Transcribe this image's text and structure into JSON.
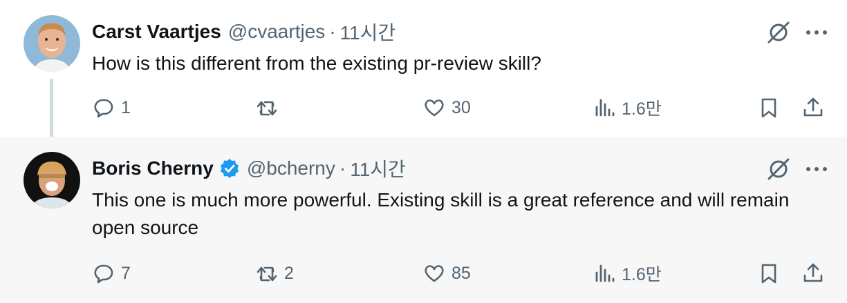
{
  "tweets": [
    {
      "author_name": "Carst Vaartjes",
      "handle": "@cvaartjes",
      "separator": "·",
      "time": "11시간",
      "text": "How is this different from the existing pr-review skill?",
      "verified": false,
      "actions": {
        "replies": "1",
        "retweets": "",
        "likes": "30",
        "views": "1.6만"
      }
    },
    {
      "author_name": "Boris Cherny",
      "handle": "@bcherny",
      "separator": "·",
      "time": "11시간",
      "text": "This one is much more powerful. Existing skill is a great reference and will remain open source",
      "verified": true,
      "actions": {
        "replies": "7",
        "retweets": "2",
        "likes": "85",
        "views": "1.6만"
      }
    }
  ],
  "colors": {
    "verified": "#1d9bf0",
    "text": "#0f1419",
    "muted": "#536471"
  },
  "icons": [
    "reply-icon",
    "retweet-icon",
    "like-icon",
    "views-icon",
    "bookmark-icon",
    "share-icon",
    "grok-icon",
    "more-icon",
    "verified-icon"
  ]
}
